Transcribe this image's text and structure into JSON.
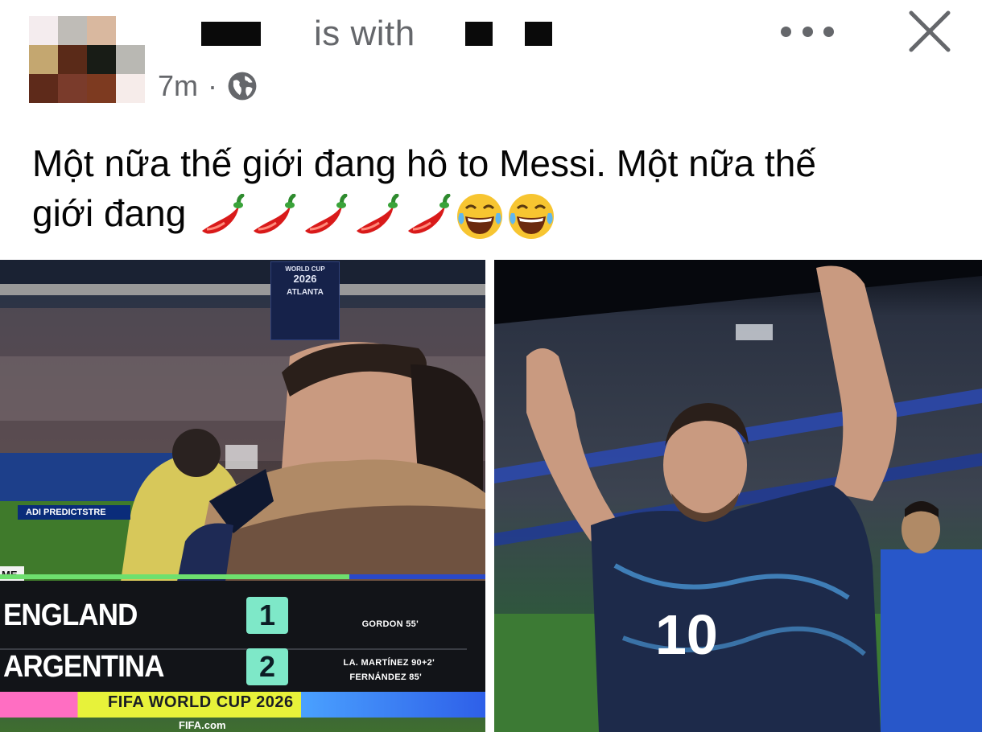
{
  "post": {
    "with_text": "is with",
    "time": "7m",
    "time_separator": "·",
    "privacy_icon": "globe-icon",
    "more_icon": "more-dots-icon",
    "close_icon": "close-icon",
    "text_line1": "Một nữa thế giới đang hô to Messi. Một nữa thế",
    "text_line2": "giới đang",
    "emojis": [
      "hot-pepper",
      "hot-pepper",
      "hot-pepper",
      "hot-pepper",
      "hot-pepper",
      "tears-of-joy",
      "tears-of-joy"
    ]
  },
  "photo1": {
    "banner_line1": "WORLD CUP",
    "banner_line2": "2026",
    "banner_line3": "ATLANTA",
    "ad_board": "ADI PREDICTSTRE",
    "tag": "ME",
    "scoreboard": {
      "rows": [
        {
          "team": "ENGLAND",
          "score": "1",
          "scorers": [
            "GORDON 55'"
          ]
        },
        {
          "team": "ARGENTINA",
          "score": "2",
          "scorers": [
            "LA. MARTÍNEZ 90+2'",
            "FERNÁNDEZ 85'"
          ]
        }
      ],
      "footer": "FIFA WORLD CUP 2026",
      "footer_url": "FIFA.com"
    }
  },
  "colors": {
    "meta_gray": "#65676b",
    "score_box": "#7ee8c8",
    "scoreboard_bg": "#121418",
    "footer_yellow": "#e7f23a"
  }
}
